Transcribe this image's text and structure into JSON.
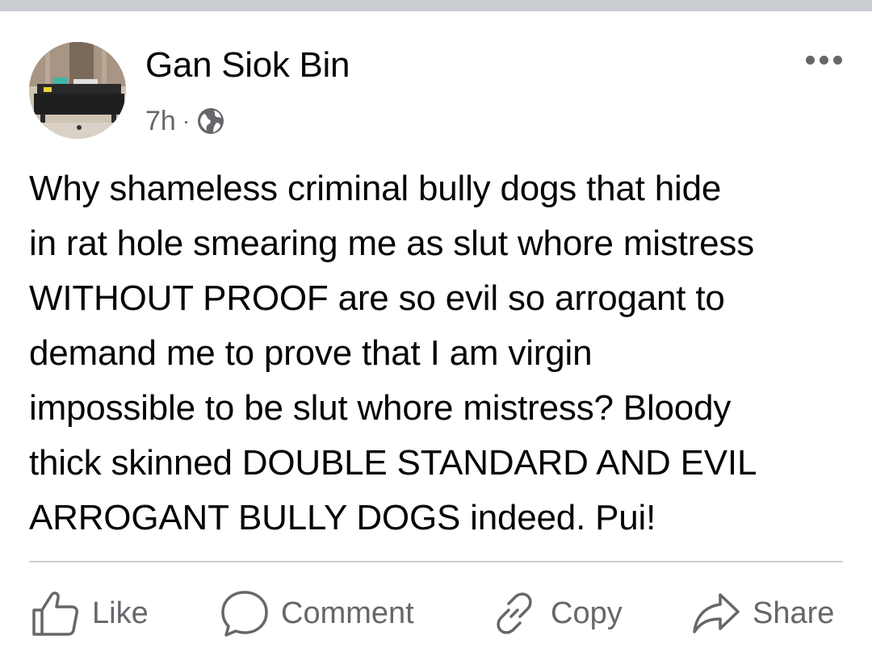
{
  "post": {
    "author": "Gan Siok Bin",
    "time": "7h",
    "separator": "·",
    "privacy_icon": "globe-icon",
    "text": "Why shameless criminal bully dogs that hide\nin rat hole smearing me as slut whore mistress\nWITHOUT PROOF are so evil so arrogant to\ndemand me to prove that I am virgin\nimpossible to be slut whore mistress? Bloody\nthick skinned DOUBLE STANDARD AND EVIL\nARROGANT BULLY DOGS indeed. Pui!"
  },
  "actions": {
    "like": "Like",
    "comment": "Comment",
    "copy": "Copy",
    "share": "Share"
  },
  "colors": {
    "text_primary": "#050505",
    "text_secondary": "#65676b",
    "divider": "#ced0d4",
    "top_band": "#c9ccd1"
  }
}
